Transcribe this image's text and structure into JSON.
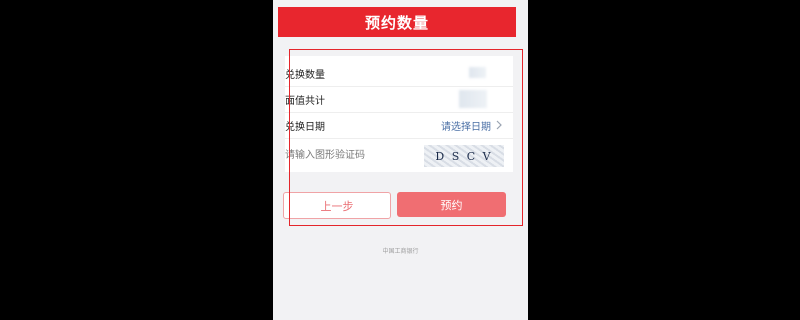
{
  "header": {
    "title": "预约数量"
  },
  "form": {
    "rows": [
      {
        "label": "兑换数量"
      },
      {
        "label": "面值共计"
      },
      {
        "label": "兑换日期",
        "value": "请选择日期"
      }
    ],
    "captcha": {
      "placeholder": "请输入图形验证码",
      "code": "D S C V"
    }
  },
  "buttons": {
    "prev": "上一步",
    "reserve": "预约"
  },
  "footer": {
    "text": "中国工商银行"
  },
  "colors": {
    "brand": "#e8262e",
    "button": "#f06e72",
    "link": "#4a6fa5"
  }
}
